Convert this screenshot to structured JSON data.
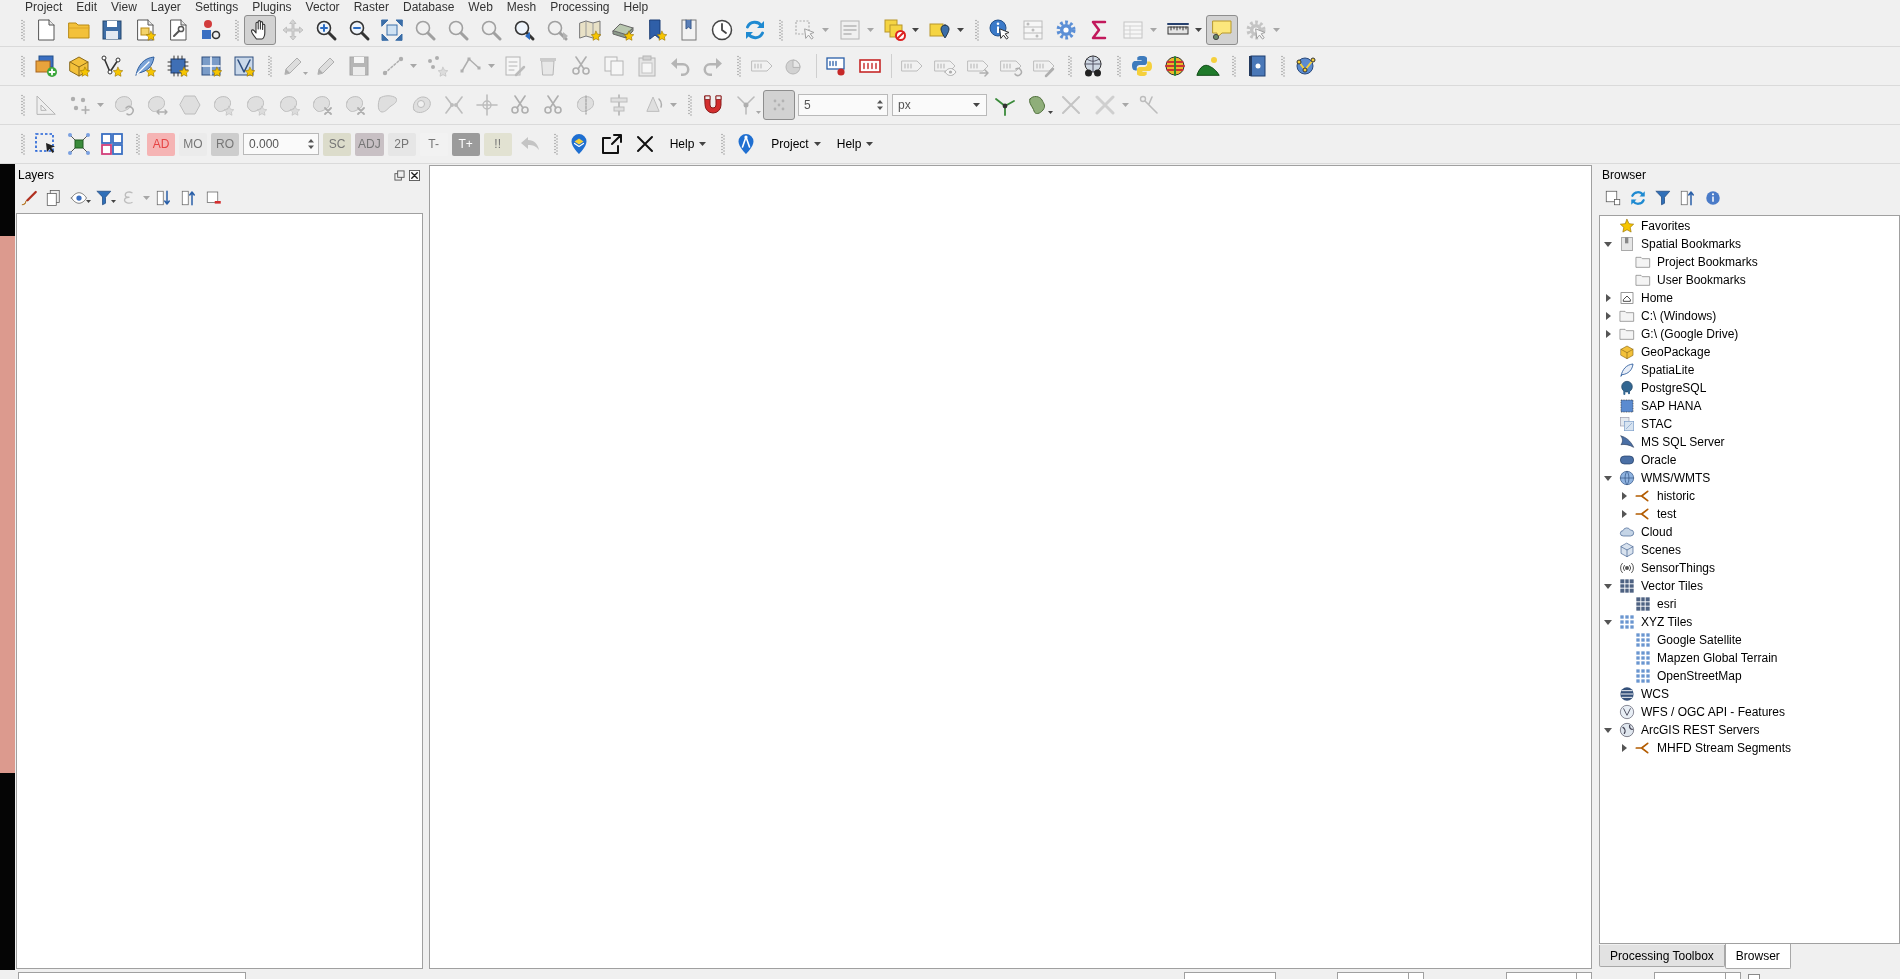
{
  "menu_bar": [
    "Project",
    "Edit",
    "View",
    "Layer",
    "Settings",
    "Plugins",
    "Vector",
    "Raster",
    "Database",
    "Web",
    "Mesh",
    "Processing",
    "Help"
  ],
  "toolbar_rows": [
    {
      "toolbars": [
        {
          "items": [
            {
              "kind": "tool",
              "disabled": false
            },
            {
              "kind": "tool",
              "disabled": false
            },
            {
              "kind": "tool",
              "disabled": false
            },
            {
              "kind": "tool",
              "disabled": false
            },
            {
              "kind": "tool",
              "disabled": false
            },
            {
              "kind": "tool",
              "disabled": false
            }
          ]
        },
        {
          "items": [
            {
              "kind": "tool",
              "disabled": false,
              "pressed": true
            },
            {
              "kind": "tool",
              "disabled": true
            },
            {
              "kind": "tool",
              "disabled": false,
              "pressed": false
            },
            {
              "kind": "tool",
              "disabled": false,
              "pressed": false
            },
            {
              "kind": "tool",
              "disabled": false
            },
            {
              "kind": "tool",
              "disabled": true
            },
            {
              "kind": "tool",
              "disabled": true
            },
            {
              "kind": "tool",
              "disabled": true
            },
            {
              "kind": "tool",
              "disabled": false
            },
            {
              "kind": "tool",
              "disabled": true
            },
            {
              "kind": "tool",
              "disabled": false
            },
            {
              "kind": "tool",
              "disabled": false
            },
            {
              "kind": "tool",
              "disabled": false
            },
            {
              "kind": "tool",
              "disabled": false
            },
            {
              "kind": "tool",
              "disabled": false
            },
            {
              "kind": "tool",
              "disabled": false
            }
          ]
        },
        {
          "items": [
            {
              "kind": "tool",
              "disabled": true
            },
            {
              "kind": "tool",
              "disabled": true
            },
            {
              "kind": "tool",
              "disabled": false
            },
            {
              "kind": "tool",
              "disabled": false
            }
          ]
        },
        {
          "items": [
            {
              "kind": "tool",
              "disabled": false,
              "pressed": false
            },
            {
              "kind": "tool",
              "disabled": true
            },
            {
              "kind": "tool",
              "disabled": false
            },
            {
              "kind": "tool",
              "disabled": false
            },
            {
              "kind": "tool",
              "disabled": true
            },
            {
              "kind": "tool",
              "disabled": false,
              "pressed": false
            },
            {
              "kind": "tool",
              "disabled": false,
              "pressed": true
            },
            {
              "kind": "tool",
              "disabled": true
            }
          ]
        }
      ]
    },
    {
      "toolbars": [
        {
          "items": [
            {
              "kind": "tool",
              "disabled": false
            },
            {
              "kind": "tool",
              "disabled": false
            },
            {
              "kind": "tool",
              "disabled": false
            },
            {
              "kind": "tool",
              "disabled": false
            },
            {
              "kind": "tool",
              "disabled": false
            },
            {
              "kind": "tool",
              "disabled": false
            },
            {
              "kind": "tool",
              "disabled": false
            }
          ]
        },
        {
          "items": [
            {
              "kind": "tool",
              "disabled": true
            },
            {
              "kind": "tool",
              "disabled": true
            },
            {
              "kind": "tool",
              "disabled": true
            },
            {
              "kind": "tool",
              "disabled": true
            },
            {
              "kind": "tool",
              "disabled": true
            },
            {
              "kind": "tool",
              "disabled": true
            },
            {
              "kind": "tool",
              "disabled": true
            },
            {
              "kind": "tool",
              "disabled": true
            },
            {
              "kind": "tool",
              "disabled": true
            },
            {
              "kind": "tool",
              "disabled": true
            },
            {
              "kind": "tool",
              "disabled": true
            },
            {
              "kind": "tool",
              "disabled": true
            },
            {
              "kind": "tool",
              "disabled": true
            }
          ]
        },
        {
          "items": [
            {
              "kind": "tool",
              "disabled": true
            },
            {
              "kind": "tool",
              "disabled": true
            },
            {
              "kind": "separator"
            },
            {
              "kind": "tool",
              "disabled": false
            },
            {
              "kind": "tool",
              "disabled": false
            },
            {
              "kind": "separator"
            },
            {
              "kind": "tool",
              "disabled": true
            },
            {
              "kind": "tool",
              "disabled": true
            },
            {
              "kind": "tool",
              "disabled": true
            },
            {
              "kind": "tool",
              "disabled": true
            },
            {
              "kind": "tool",
              "disabled": true
            }
          ]
        },
        {
          "items": [
            {
              "kind": "tool",
              "disabled": false
            }
          ]
        },
        {
          "items": [
            {
              "kind": "tool",
              "disabled": false
            },
            {
              "kind": "tool",
              "disabled": false
            },
            {
              "kind": "tool",
              "disabled": false
            }
          ]
        },
        {
          "items": [
            {
              "kind": "tool",
              "disabled": false
            }
          ]
        },
        {
          "items": [
            {
              "kind": "tool",
              "disabled": false
            }
          ]
        }
      ]
    },
    {
      "toolbars": [
        {
          "items": [
            {
              "kind": "tool",
              "disabled": true
            },
            {
              "kind": "tool",
              "disabled": true
            },
            {
              "kind": "tool",
              "disabled": true
            },
            {
              "kind": "tool",
              "disabled": true
            },
            {
              "kind": "tool",
              "disabled": true
            },
            {
              "kind": "tool",
              "disabled": true
            },
            {
              "kind": "tool",
              "disabled": true
            },
            {
              "kind": "tool",
              "disabled": true
            },
            {
              "kind": "tool",
              "disabled": true
            },
            {
              "kind": "tool",
              "disabled": true
            },
            {
              "kind": "tool",
              "disabled": true
            },
            {
              "kind": "tool",
              "disabled": true
            },
            {
              "kind": "tool",
              "disabled": true
            },
            {
              "kind": "tool",
              "disabled": true
            },
            {
              "kind": "tool",
              "disabled": true
            },
            {
              "kind": "tool",
              "disabled": true
            },
            {
              "kind": "tool",
              "disabled": true
            },
            {
              "kind": "tool",
              "disabled": true
            },
            {
              "kind": "tool",
              "disabled": true
            }
          ]
        },
        {
          "items": [
            {
              "kind": "tool",
              "disabled": false,
              "pressed": false
            },
            {
              "kind": "tool",
              "disabled": true
            },
            {
              "kind": "tool",
              "disabled": true,
              "pressed": true
            },
            {
              "kind": "spin",
              "value": "5"
            },
            {
              "kind": "combo",
              "value": "px"
            },
            {
              "kind": "tool",
              "disabled": false,
              "pressed": false
            },
            {
              "kind": "tool",
              "disabled": false
            },
            {
              "kind": "tool",
              "disabled": true
            },
            {
              "kind": "tool",
              "disabled": true
            },
            {
              "kind": "tool",
              "disabled": true
            }
          ]
        }
      ]
    },
    {
      "toolbars": [
        {
          "items": [
            {
              "kind": "tool",
              "disabled": false
            },
            {
              "kind": "tool",
              "disabled": false
            },
            {
              "kind": "tool",
              "disabled": false
            }
          ]
        },
        {
          "items": [
            {
              "kind": "text",
              "label": "AD",
              "color": "#f5b4b4",
              "disabled": false
            },
            {
              "kind": "text",
              "label": "MO",
              "color": "#ebebeb",
              "disabled": true
            },
            {
              "kind": "text",
              "label": "RO",
              "color": "#cdcdcd",
              "disabled": true
            },
            {
              "kind": "spin",
              "value": "0.000"
            },
            {
              "kind": "text",
              "label": "SC",
              "color": "#dcdccb",
              "disabled": true
            },
            {
              "kind": "text",
              "label": "ADJ",
              "color": "#c8c0c4",
              "disabled": true
            },
            {
              "kind": "text",
              "label": "2P",
              "color": "#e6e6e6",
              "disabled": true
            },
            {
              "kind": "text",
              "label": "T-",
              "color": "#f2f2f2",
              "disabled": true
            },
            {
              "kind": "text",
              "label": "T+",
              "color": "#9b9b9b",
              "disabled": false
            },
            {
              "kind": "text",
              "label": "!!",
              "color": "#e2e2d2",
              "disabled": true
            },
            {
              "kind": "tool",
              "disabled": true
            }
          ]
        },
        {
          "items": [
            {
              "kind": "tool",
              "disabled": false
            },
            {
              "kind": "tool",
              "disabled": false
            },
            {
              "kind": "tool",
              "disabled": false
            },
            {
              "kind": "menu",
              "label": "Help"
            }
          ]
        },
        {
          "items": [
            {
              "kind": "tool",
              "disabled": false
            },
            {
              "kind": "menu",
              "label": "Project"
            },
            {
              "kind": "menu",
              "label": "Help"
            }
          ]
        }
      ]
    }
  ],
  "layers_panel": {
    "title": "Layers",
    "tools": [
      {
        "disabled": false
      },
      {
        "disabled": false
      },
      {
        "disabled": false
      },
      {
        "disabled": false
      },
      {
        "disabled": true
      },
      {
        "disabled": false
      },
      {
        "disabled": false
      },
      {
        "disabled": false
      }
    ]
  },
  "browser_panel": {
    "title": "Browser",
    "tools": [
      {
        "disabled": false
      },
      {
        "disabled": false
      },
      {
        "disabled": false
      },
      {
        "disabled": false
      },
      {
        "disabled": false
      }
    ],
    "tree": [
      {
        "label": "Favorites",
        "kind": "favorites"
      },
      {
        "label": "Spatial Bookmarks",
        "kind": "bookmarks",
        "expanded": true,
        "children": [
          {
            "label": "Project Bookmarks",
            "kind": "folder"
          },
          {
            "label": "User Bookmarks",
            "kind": "folder"
          }
        ]
      },
      {
        "label": "Home",
        "kind": "home",
        "expanded": false
      },
      {
        "label": "C:\\ (Windows)",
        "kind": "drive",
        "expanded": false
      },
      {
        "label": "G:\\ (Google Drive)",
        "kind": "drive",
        "expanded": false
      },
      {
        "label": "GeoPackage",
        "kind": "geopackage"
      },
      {
        "label": "SpatiaLite",
        "kind": "spatialite"
      },
      {
        "label": "PostgreSQL",
        "kind": "postgres"
      },
      {
        "label": "SAP HANA",
        "kind": "saphana"
      },
      {
        "label": "STAC",
        "kind": "stac"
      },
      {
        "label": "MS SQL Server",
        "kind": "mssql"
      },
      {
        "label": "Oracle",
        "kind": "oracle"
      },
      {
        "label": "WMS/WMTS",
        "kind": "wms",
        "expanded": true,
        "children": [
          {
            "label": "historic",
            "kind": "connection",
            "expanded": false
          },
          {
            "label": "test",
            "kind": "connection",
            "expanded": false
          }
        ]
      },
      {
        "label": "Cloud",
        "kind": "cloud"
      },
      {
        "label": "Scenes",
        "kind": "scenes"
      },
      {
        "label": "SensorThings",
        "kind": "sensor"
      },
      {
        "label": "Vector Tiles",
        "kind": "vectortile",
        "expanded": true,
        "children": [
          {
            "label": "esri",
            "kind": "vectortile"
          }
        ]
      },
      {
        "label": "XYZ Tiles",
        "kind": "xyz",
        "expanded": true,
        "children": [
          {
            "label": "Google Satellite",
            "kind": "xyz"
          },
          {
            "label": "Mapzen Global Terrain",
            "kind": "xyz"
          },
          {
            "label": "OpenStreetMap",
            "kind": "xyz"
          }
        ]
      },
      {
        "label": "WCS",
        "kind": "wcs"
      },
      {
        "label": "WFS / OGC API - Features",
        "kind": "wfs"
      },
      {
        "label": "ArcGIS REST Servers",
        "kind": "arcgis",
        "expanded": true,
        "children": [
          {
            "label": "MHFD Stream Segments",
            "kind": "connection",
            "expanded": false
          }
        ]
      }
    ]
  },
  "dock_tabs": [
    {
      "label": "Processing Toolbox",
      "selected": false
    },
    {
      "label": "Browser",
      "selected": true
    }
  ]
}
